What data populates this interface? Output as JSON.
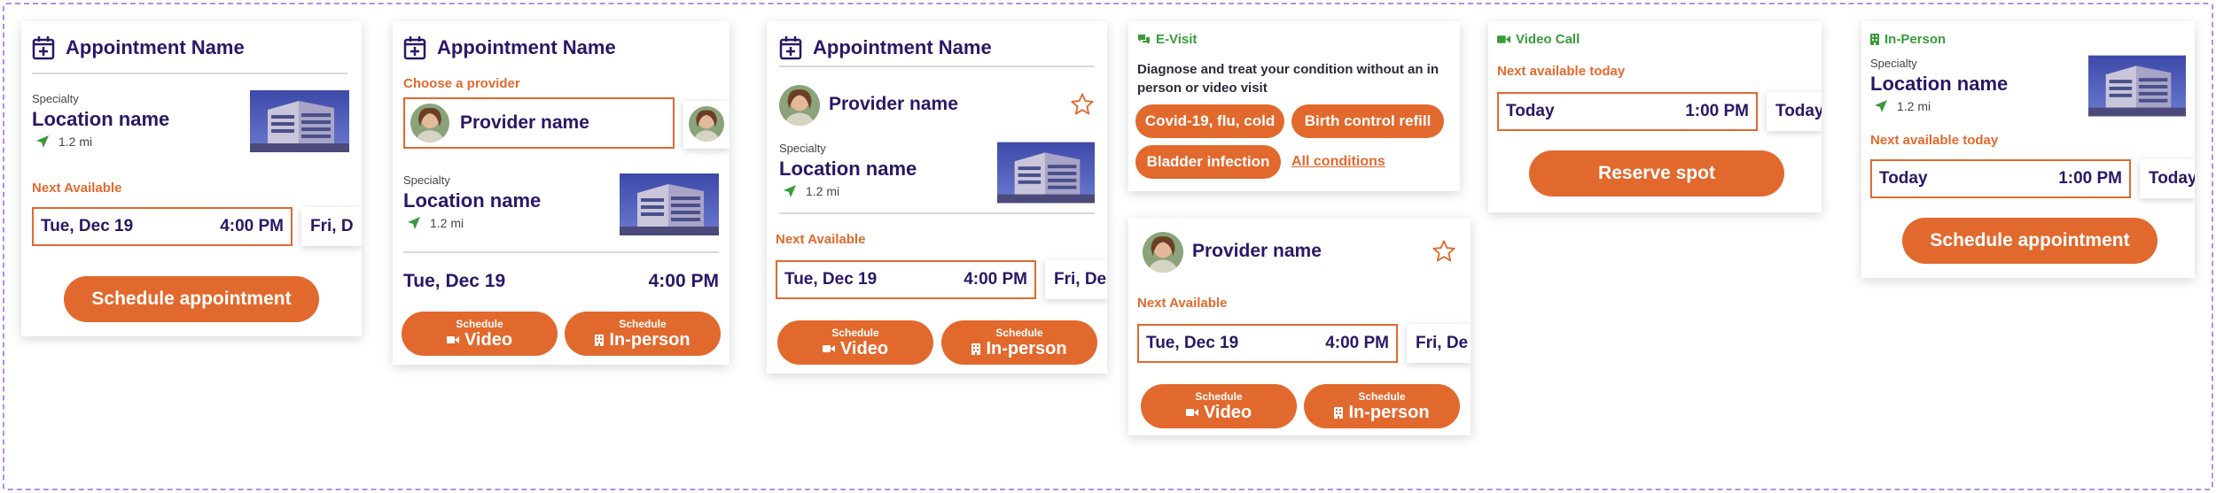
{
  "colors": {
    "accent": "#e2692d",
    "brand": "#2b1766",
    "green": "#3a9a3c"
  },
  "card1": {
    "title": "Appointment Name",
    "specialty": "Specialty",
    "location": "Location name",
    "distance": "1.2 mi",
    "next_label": "Next Available",
    "slot_date": "Tue, Dec 19",
    "slot_time": "4:00 PM",
    "ghost": "Fri, D",
    "button": "Schedule appointment"
  },
  "card2": {
    "title": "Appointment Name",
    "choose": "Choose a provider",
    "provider": "Provider name",
    "specialty": "Specialty",
    "location": "Location name",
    "distance": "1.2 mi",
    "date": "Tue, Dec 19",
    "time": "4:00 PM",
    "btn_sub": "Schedule",
    "btn_video": "Video",
    "btn_inperson": "In-person"
  },
  "card3": {
    "title": "Appointment Name",
    "provider": "Provider name",
    "specialty": "Specialty",
    "location": "Location name",
    "distance": "1.2 mi",
    "next_label": "Next Available",
    "slot_date": "Tue, Dec 19",
    "slot_time": "4:00 PM",
    "ghost": "Fri, De",
    "btn_sub": "Schedule",
    "btn_video": "Video",
    "btn_inperson": "In-person"
  },
  "card4": {
    "badge": "E-Visit",
    "description": "Diagnose and treat your condition without an in person or video visit",
    "chips": [
      "Covid-19, flu, cold",
      "Birth control refill",
      "Bladder infection"
    ],
    "all_link": "All conditions"
  },
  "card5": {
    "provider": "Provider name",
    "next_label": "Next Available",
    "slot_date": "Tue, Dec 19",
    "slot_time": "4:00 PM",
    "ghost": "Fri, De",
    "btn_sub": "Schedule",
    "btn_video": "Video",
    "btn_inperson": "In-person"
  },
  "card6": {
    "badge": "Video Call",
    "next_label": "Next available today",
    "slot_date": "Today",
    "slot_time": "1:00 PM",
    "ghost": "Today",
    "button": "Reserve spot"
  },
  "card7": {
    "badge": "In-Person",
    "specialty": "Specialty",
    "location": "Location name",
    "distance": "1.2 mi",
    "next_label": "Next available today",
    "slot_date": "Today",
    "slot_time": "1:00 PM",
    "ghost": "Today",
    "button": "Schedule appointment"
  }
}
